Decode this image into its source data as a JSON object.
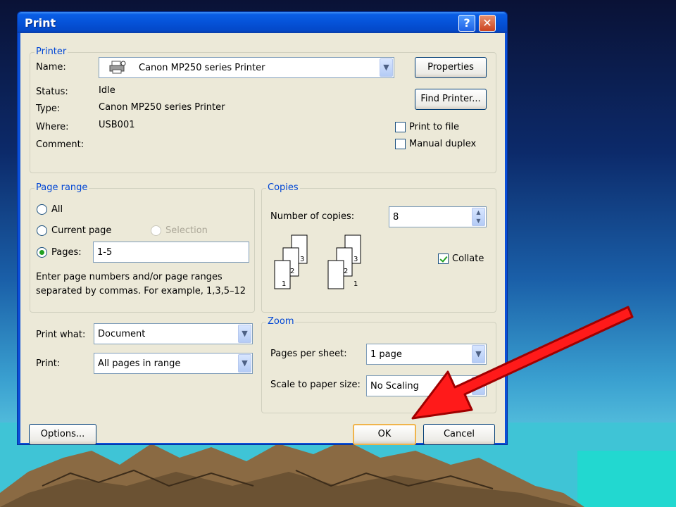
{
  "window": {
    "title": "Print"
  },
  "printer_group": {
    "label": "Printer",
    "name_label": "Name:",
    "name_value": "Canon MP250 series Printer",
    "status_label": "Status:",
    "status_value": "Idle",
    "type_label": "Type:",
    "type_value": "Canon MP250 series Printer",
    "where_label": "Where:",
    "where_value": "USB001",
    "comment_label": "Comment:",
    "properties_button": "Properties",
    "find_printer_button": "Find Printer...",
    "print_to_file_label": "Print to file",
    "manual_duplex_label": "Manual duplex"
  },
  "page_range_group": {
    "label": "Page range",
    "all_label": "All",
    "current_page_label": "Current page",
    "selection_label": "Selection",
    "pages_label": "Pages:",
    "pages_value": "1-5",
    "hint_line1": "Enter page numbers and/or page ranges",
    "hint_line2": "separated by commas.  For example, 1,3,5–12"
  },
  "copies_group": {
    "label": "Copies",
    "number_label": "Number of copies:",
    "number_value": "8",
    "collate_label": "Collate",
    "collate_checked": true,
    "page_numbers": [
      "1",
      "2",
      "3"
    ]
  },
  "print_what": {
    "label": "Print what:",
    "value": "Document"
  },
  "print": {
    "label": "Print:",
    "value": "All pages in range"
  },
  "zoom_group": {
    "label": "Zoom",
    "pages_per_sheet_label": "Pages per sheet:",
    "pages_per_sheet_value": "1 page",
    "scale_label": "Scale to paper size:",
    "scale_value": "No Scaling"
  },
  "footer": {
    "options_button": "Options...",
    "ok_button": "OK",
    "cancel_button": "Cancel"
  },
  "colors": {
    "arrow": "#ff1a1a",
    "group_label": "#0046d5",
    "titlebar": "#0552d8"
  }
}
